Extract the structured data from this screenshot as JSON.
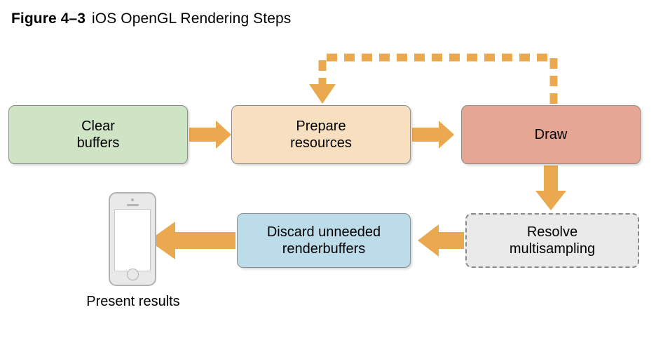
{
  "figure": {
    "number": "Figure 4–3",
    "caption": "iOS OpenGL Rendering Steps"
  },
  "colors": {
    "arrow": "#eaa84f",
    "clear_fill": "#cfe3c5",
    "prepare_fill": "#f8dfc0",
    "draw_fill": "#e5a794",
    "resolve_fill": "#eaeaea",
    "discard_fill": "#bcdcea",
    "node_border": "#8d8d8d",
    "dashed_border": "#8a8a8a",
    "phone_body": "#e9e9e9",
    "phone_border": "#b3b3b3",
    "text": "#000000",
    "background": "#ffffff"
  },
  "nodes": {
    "clear": {
      "label": "Clear\nbuffers",
      "style": "solid",
      "fill": "#cfe3c5"
    },
    "prepare": {
      "label": "Prepare\nresources",
      "style": "solid",
      "fill": "#f8dfc0"
    },
    "draw": {
      "label": "Draw",
      "style": "solid",
      "fill": "#e5a794"
    },
    "resolve": {
      "label": "Resolve\nmultisampling",
      "style": "dashed",
      "fill": "#eaeaea"
    },
    "discard": {
      "label": "Discard unneeded\nrenderbuffers",
      "style": "solid",
      "fill": "#bcdcea"
    }
  },
  "device": {
    "caption": "Present results",
    "kind": "iphone"
  },
  "flow": [
    {
      "from": "clear",
      "to": "prepare",
      "style": "solid",
      "direction": "right"
    },
    {
      "from": "prepare",
      "to": "draw",
      "style": "solid",
      "direction": "right"
    },
    {
      "from": "draw",
      "to": "prepare",
      "style": "dashed",
      "direction": "loop-back-up"
    },
    {
      "from": "draw",
      "to": "resolve",
      "style": "solid",
      "direction": "down"
    },
    {
      "from": "resolve",
      "to": "discard",
      "style": "solid",
      "direction": "left"
    },
    {
      "from": "discard",
      "to": "device",
      "style": "solid",
      "direction": "left"
    }
  ]
}
